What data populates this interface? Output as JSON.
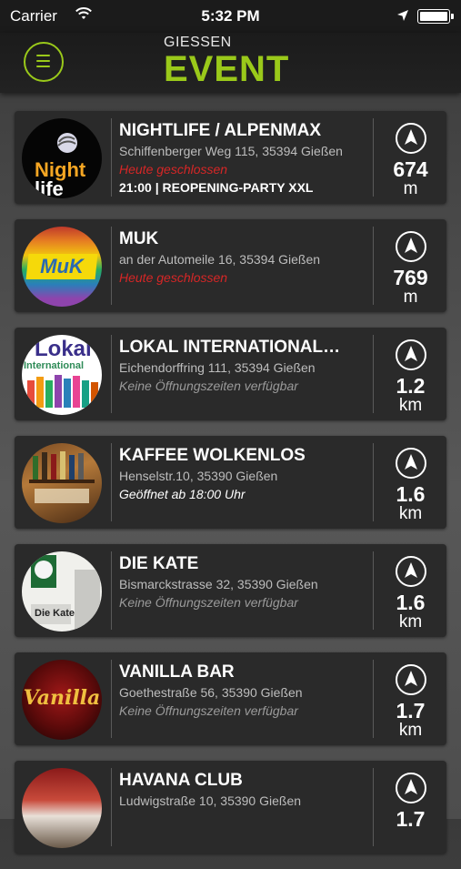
{
  "status_bar": {
    "carrier": "Carrier",
    "time": "5:32 PM"
  },
  "header": {
    "brand_top": "GIESSEN",
    "brand_main": "EVENT",
    "accent_color": "#9ac91a",
    "menu_icon": "hamburger-menu-icon"
  },
  "venues": [
    {
      "name": "NIGHTLIFE / ALPENMAX",
      "address": "Schiffenberger Weg 115, 35394 Gießen",
      "hours": "Heute geschlossen",
      "hours_state": "closed",
      "event": "21:00 | REOPENING-PARTY XXL",
      "distance": "674",
      "unit": "m",
      "logo_text": "Night life"
    },
    {
      "name": "MUK",
      "address": "an der Automeile 16, 35394 Gießen",
      "hours": "Heute geschlossen",
      "hours_state": "closed",
      "event": "",
      "distance": "769",
      "unit": "m",
      "logo_text": "MuK"
    },
    {
      "name": "LOKAL INTERNATIONAL…",
      "address": "Eichendorffring 111, 35394 Gießen",
      "hours": "Keine Öffnungszeiten verfügbar",
      "hours_state": "none",
      "event": "",
      "distance": "1.2",
      "unit": "km",
      "logo_text": "Lokal International"
    },
    {
      "name": "KAFFEE WOLKENLOS",
      "address": "Henselstr.10, 35390 Gießen",
      "hours": "Geöffnet ab 18:00 Uhr",
      "hours_state": "open",
      "event": "",
      "distance": "1.6",
      "unit": "km",
      "logo_text": ""
    },
    {
      "name": "DIE KATE",
      "address": "Bismarckstrasse 32, 35390 Gießen",
      "hours": "Keine Öffnungszeiten verfügbar",
      "hours_state": "none",
      "event": "",
      "distance": "1.6",
      "unit": "km",
      "logo_text": "Die Kate"
    },
    {
      "name": "VANILLA BAR",
      "address": "Goethestraße 56, 35390 Gießen",
      "hours": "Keine Öffnungszeiten verfügbar",
      "hours_state": "none",
      "event": "",
      "distance": "1.7",
      "unit": "km",
      "logo_text": "Vanilla"
    },
    {
      "name": "HAVANA CLUB",
      "address": "Ludwigstraße 10, 35390 Gießen",
      "hours": "",
      "hours_state": "none",
      "event": "",
      "distance": "1.7",
      "unit": "",
      "logo_text": ""
    }
  ],
  "colors": {
    "closed": "#d62626",
    "card_bg": "#2a2a2a"
  }
}
